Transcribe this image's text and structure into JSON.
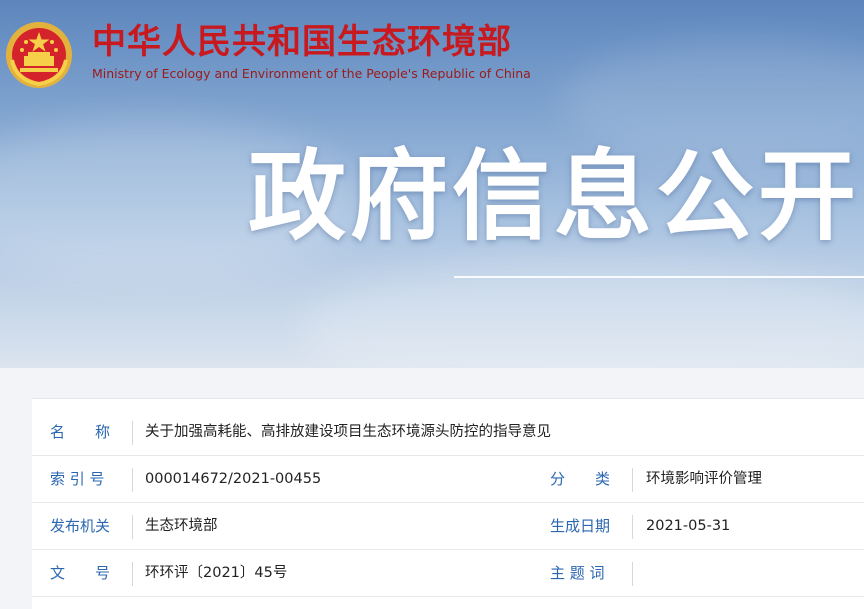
{
  "header": {
    "ministry_cn": "中华人民共和国生态环境部",
    "ministry_en": "Ministry of Ecology and Environment of the People's Republic of China",
    "banner_title": "政府信息公开",
    "emblem_icon": "national-emblem-icon"
  },
  "colors": {
    "brand_red": "#c8191f",
    "label_blue": "#2b67b1"
  },
  "info": {
    "name": {
      "label": "名　　称",
      "value": "关于加强高耗能、高排放建设项目生态环境源头防控的指导意见"
    },
    "index_no": {
      "label": "索 引 号",
      "value": "000014672/2021-00455"
    },
    "category": {
      "label": "分　　类",
      "value": "环境影响评价管理"
    },
    "issuer": {
      "label": "发布机关",
      "value": "生态环境部"
    },
    "date": {
      "label": "生成日期",
      "value": "2021-05-31"
    },
    "doc_no": {
      "label": "文　　号",
      "value": "环环评〔2021〕45号"
    },
    "subject": {
      "label": "主 题 词",
      "value": ""
    }
  }
}
